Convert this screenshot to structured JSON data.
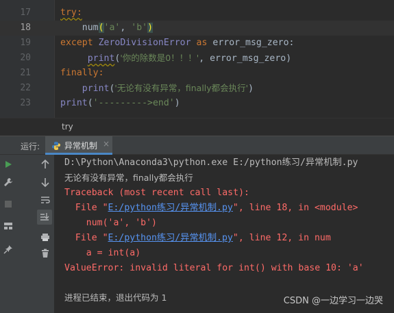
{
  "editor": {
    "lines": [
      {
        "num": "17",
        "current": false
      },
      {
        "num": "18",
        "current": true
      },
      {
        "num": "19",
        "current": false
      },
      {
        "num": "20",
        "current": false
      },
      {
        "num": "21",
        "current": false
      },
      {
        "num": "22",
        "current": false
      },
      {
        "num": "23",
        "current": false
      }
    ],
    "code": {
      "l17_try": "try:",
      "l18_num": "num",
      "l18_open": "(",
      "l18_a": "'a'",
      "l18_comma": ", ",
      "l18_b": "'b'",
      "l18_close": ")",
      "l19_except": "except",
      "l19_exc": "ZeroDivisionError",
      "l19_as": "as",
      "l19_var": "error_msg_zero:",
      "l20_print": "print",
      "l20_str": "'你的除数是0！！！'",
      "l20_rest": ", error_msg_zero)",
      "l21_finally": "finally:",
      "l22_print": "print",
      "l22_str": "'无论有没有异常，finally都会执行'",
      "l23_print": "print",
      "l23_str": "'--------->end'",
      "paren_open": "(",
      "paren_close": ")"
    }
  },
  "breadcrumb": {
    "label": "try"
  },
  "run_panel": {
    "label": "运行:",
    "tab_title": "异常机制",
    "tab_close": "×"
  },
  "console": {
    "cmd": "D:\\Python\\Anaconda3\\python.exe E:/python练习/异常机制.py",
    "finally_out": "无论有没有异常，finally都会执行",
    "traceback_header": "Traceback (most recent call last):",
    "frame1_pre": "  File \"",
    "frame1_link": "E:/python练习/异常机制.py",
    "frame1_post": "\", line 18, in <module>",
    "frame1_code": "    num('a', 'b')",
    "frame2_pre": "  File \"",
    "frame2_link": "E:/python练习/异常机制.py",
    "frame2_post": "\", line 12, in num",
    "frame2_code": "    a = int(a)",
    "error": "ValueError: invalid literal for int() with base 10: 'a'",
    "exit": "进程已结束，退出代码为 1"
  },
  "watermark": "CSDN @一边学习一边哭",
  "colors": {
    "keyword": "#cc7832",
    "string": "#6a8759",
    "builtin": "#8888c6",
    "error": "#ff6b68",
    "link": "#5794f2"
  },
  "icons": [
    "run-icon",
    "wrench-icon",
    "stop-icon",
    "layout-icon",
    "pin-icon",
    "arrow-up-icon",
    "arrow-down-icon",
    "soft-wrap-icon",
    "scroll-end-icon",
    "print-icon",
    "trash-icon",
    "python-icon"
  ]
}
